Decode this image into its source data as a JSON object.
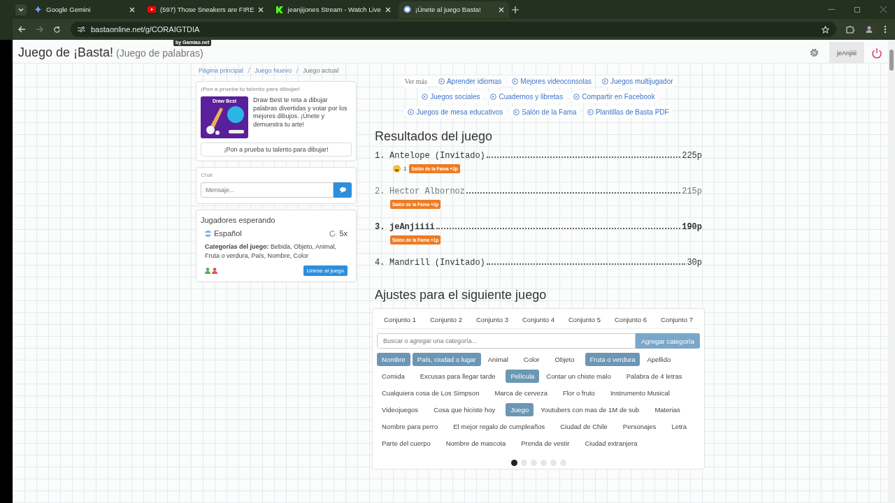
{
  "browser": {
    "tabs": [
      {
        "title": "Google Gemini",
        "selected": false
      },
      {
        "title": "(597) Those Sneakers are FIRE",
        "selected": false
      },
      {
        "title": "jeanjijones Stream - Watch Live",
        "selected": false
      },
      {
        "title": "¡Únete al juego Basta!",
        "selected": true
      }
    ],
    "url": "bastaonline.net/g/CORAIGTDIA"
  },
  "header": {
    "title": "Juego de ¡Basta!",
    "subtitle": "(Juego de palabras)",
    "badge": "by Gamiao.net",
    "user": "jeAnjiiii"
  },
  "breadcrumb": [
    {
      "label": "Página principal",
      "link": true
    },
    {
      "label": "Juego Nuevo",
      "link": true
    },
    {
      "label": "Juego actual",
      "link": false
    }
  ],
  "promo": {
    "heading": "¡Pon a prueba tu talento para dibujar!",
    "image_title": "Draw Best",
    "text": "Draw Best te reta a dibujar palabras divertidas y votar por los mejores dibujos. ¡Únete y demuestra tu arte!",
    "button": "¡Pon a prueba tu talento para dibujar!"
  },
  "chat": {
    "title": "Chat",
    "placeholder": "Mensaje..."
  },
  "waiting": {
    "title": "Jugadores esperando",
    "language": "Español",
    "rounds": "5x",
    "categories_label": "Categorías del juego:",
    "categories": "Bebida, Objeto, Animal, Fruta o verdura, País, Nombre, Color",
    "join": "Unirse al juego"
  },
  "more": {
    "label": "Ver más",
    "links": [
      {
        "label": "Aprender idiomas"
      },
      {
        "label": "Mejores videoconsolas"
      },
      {
        "label": "Juegos multijugador"
      },
      {
        "label": "Juegos sociales"
      },
      {
        "label": "Cuadernos y libretas"
      },
      {
        "label": "Compartir en Facebook"
      },
      {
        "label": "Juegos de mesa educativos"
      },
      {
        "label": "Salón de la Fama"
      },
      {
        "label": "Plantillas de Basta PDF"
      }
    ]
  },
  "results": {
    "title": "Resultados del juego",
    "rows": [
      {
        "rank": "1.",
        "name": "Antelope (Invitado)",
        "score": "225p",
        "current_user": false,
        "dimmed": false,
        "reaction": "1",
        "award": "Salón de la Fama +3p"
      },
      {
        "rank": "2.",
        "name": "Hector Albornoz",
        "score": "215p",
        "current_user": false,
        "dimmed": true,
        "award": "Salón de la Fama +2p"
      },
      {
        "rank": "3.",
        "name": "jeAnjiiii",
        "score": "190p",
        "current_user": true,
        "dimmed": false,
        "award": "Salón de la Fama +1p"
      },
      {
        "rank": "4.",
        "name": "Mandrill (Invitado)",
        "score": "30p",
        "current_user": false,
        "dimmed": false
      }
    ]
  },
  "settings": {
    "title": "Ajustes para el siguiente juego",
    "sets": [
      "Conjunto 1",
      "Conjunto 2",
      "Conjunto 3",
      "Conjunto 4",
      "Conjunto 5",
      "Conjunto 6",
      "Conjunto 7"
    ],
    "search_placeholder": "Buscar o agregar una categoría...",
    "add_button": "Agregar categoría",
    "categories": [
      {
        "label": "Nombre",
        "selected": true
      },
      {
        "label": "País, ciudad o lugar",
        "selected": true
      },
      {
        "label": "Animal",
        "selected": false
      },
      {
        "label": "Color",
        "selected": false
      },
      {
        "label": "Objeto",
        "selected": false
      },
      {
        "label": "Fruta o verdura",
        "selected": true
      },
      {
        "label": "Apellido",
        "selected": false
      },
      {
        "label": "Comida",
        "selected": false
      },
      {
        "label": "Excusas para llegar tarde",
        "selected": false
      },
      {
        "label": "Película",
        "selected": true
      },
      {
        "label": "Contar un chiste malo",
        "selected": false
      },
      {
        "label": "Palabra de 4 letras",
        "selected": false
      },
      {
        "label": "Cualquiera cosa de Los Simpson",
        "selected": false
      },
      {
        "label": "Marca de cerveza",
        "selected": false
      },
      {
        "label": "Flor o fruto",
        "selected": false
      },
      {
        "label": "Instrumento Musical",
        "selected": false
      },
      {
        "label": "Videojuegos",
        "selected": false
      },
      {
        "label": "Cosa que hiciste hoy",
        "selected": false
      },
      {
        "label": "Juego",
        "selected": true
      },
      {
        "label": "Youtubers con mas de 1M de sub",
        "selected": false
      },
      {
        "label": "Materias",
        "selected": false
      },
      {
        "label": "Nombre para perro",
        "selected": false
      },
      {
        "label": "El mejor regalo de cumpleaños",
        "selected": false
      },
      {
        "label": "Ciudad de Chile",
        "selected": false
      },
      {
        "label": "Personajes",
        "selected": false
      },
      {
        "label": "Letra",
        "selected": false
      },
      {
        "label": "Parte del cuerpo",
        "selected": false
      },
      {
        "label": "Nombre de mascota",
        "selected": false
      },
      {
        "label": "Prenda de vestir",
        "selected": false
      },
      {
        "label": "Ciudad extranjera",
        "selected": false
      }
    ],
    "pages": [
      {
        "selected": true
      },
      {
        "selected": false
      },
      {
        "selected": false
      },
      {
        "selected": false
      },
      {
        "selected": false
      },
      {
        "selected": false
      }
    ]
  }
}
